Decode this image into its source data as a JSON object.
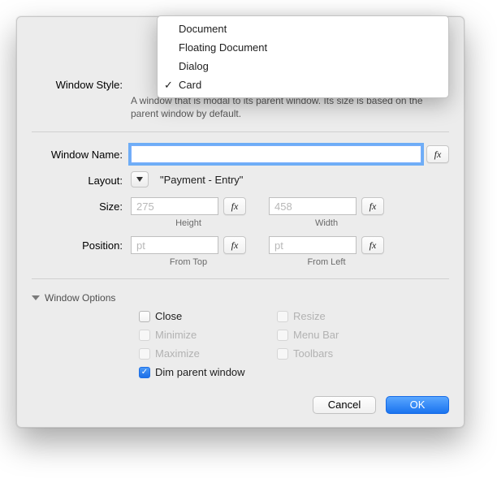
{
  "popup": {
    "items": [
      {
        "label": "Document",
        "selected": false
      },
      {
        "label": "Floating Document",
        "selected": false
      },
      {
        "label": "Dialog",
        "selected": false
      },
      {
        "label": "Card",
        "selected": true
      }
    ]
  },
  "labels": {
    "window_style": "Window Style:",
    "window_name": "Window Name:",
    "layout": "Layout:",
    "size": "Size:",
    "position": "Position:",
    "window_options": "Window Options"
  },
  "desc": "A window that is modal to its parent window. Its size is based on the parent window by default.",
  "name_input": {
    "value": "",
    "placeholder": ""
  },
  "layout_value": "\"Payment - Entry\"",
  "size": {
    "height": {
      "placeholder": "275",
      "value": ""
    },
    "width": {
      "placeholder": "458",
      "value": ""
    },
    "height_label": "Height",
    "width_label": "Width"
  },
  "position": {
    "top": {
      "placeholder": "pt",
      "value": ""
    },
    "left": {
      "placeholder": "pt",
      "value": ""
    },
    "top_label": "From Top",
    "left_label": "From Left"
  },
  "fx": "fx",
  "options": {
    "close": {
      "label": "Close",
      "checked": false,
      "enabled": true
    },
    "resize": {
      "label": "Resize",
      "checked": false,
      "enabled": false
    },
    "minimize": {
      "label": "Minimize",
      "checked": false,
      "enabled": false
    },
    "menubar": {
      "label": "Menu Bar",
      "checked": false,
      "enabled": false
    },
    "maximize": {
      "label": "Maximize",
      "checked": false,
      "enabled": false
    },
    "toolbars": {
      "label": "Toolbars",
      "checked": false,
      "enabled": false
    },
    "dim": {
      "label": "Dim parent window",
      "checked": true,
      "enabled": true
    }
  },
  "buttons": {
    "cancel": "Cancel",
    "ok": "OK"
  },
  "glyphs": {
    "check": "✓"
  }
}
